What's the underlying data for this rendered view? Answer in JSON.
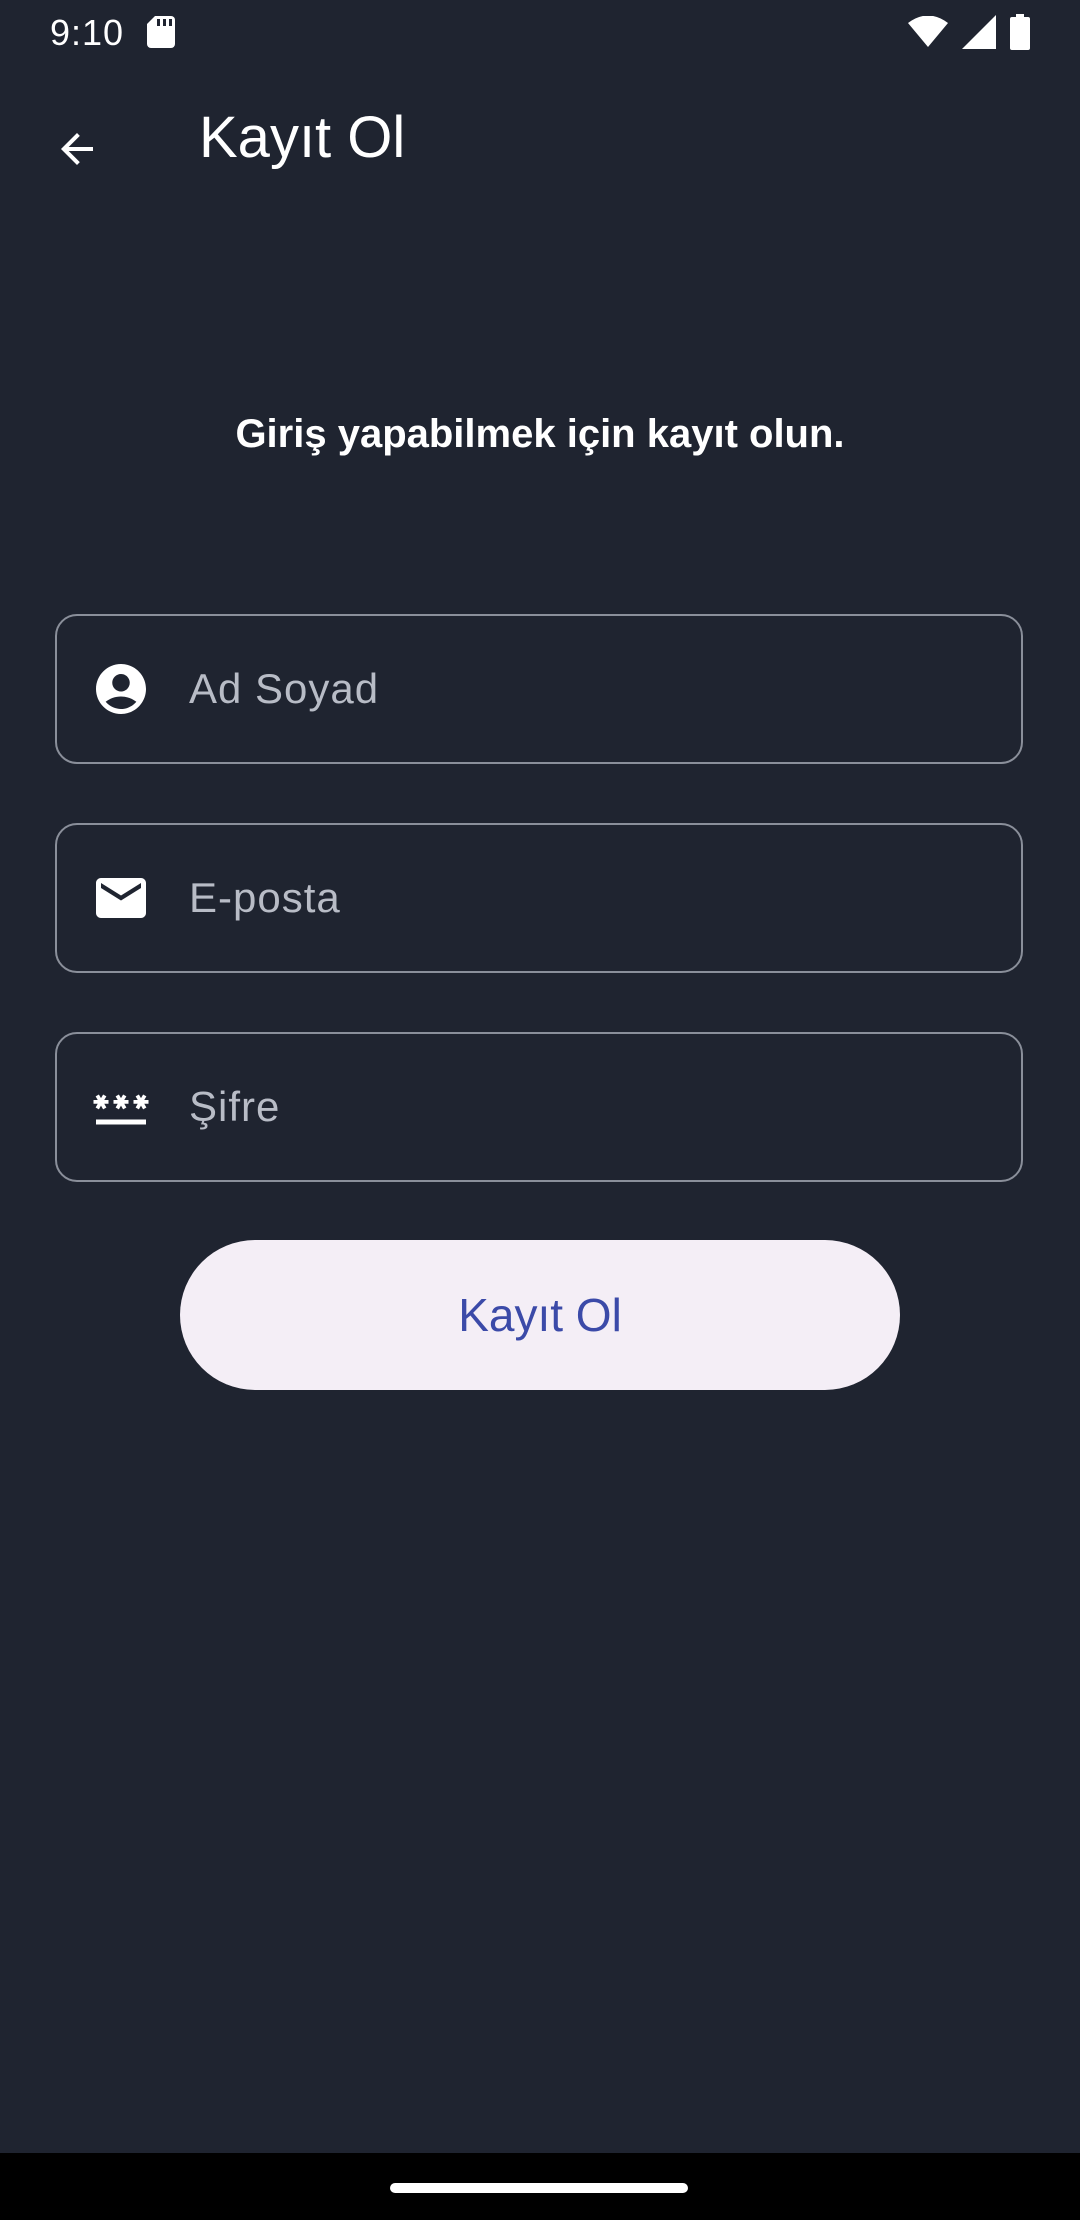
{
  "status_bar": {
    "time": "9:10"
  },
  "app_bar": {
    "title": "Kayıt Ol",
    "back_icon": "arrow-back-icon"
  },
  "subtitle": "Giriş yapabilmek için kayıt olun.",
  "form": {
    "name": {
      "placeholder": "Ad Soyad",
      "value": "",
      "icon": "account-circle-icon"
    },
    "email": {
      "placeholder": "E-posta",
      "value": "",
      "icon": "mail-icon"
    },
    "password": {
      "placeholder": "Şifre",
      "value": "",
      "icon": "password-icon"
    }
  },
  "register_button": {
    "label": "Kayıt Ol"
  },
  "colors": {
    "background": "#1f2430",
    "field_border": "#8a8f9a",
    "button_bg": "#f4eef6",
    "button_text": "#3b4aa8"
  }
}
